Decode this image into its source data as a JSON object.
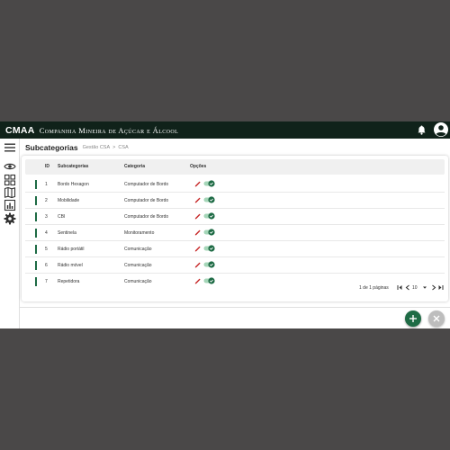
{
  "topbar": {
    "brand": "CMAA",
    "brand_subtitle": "Companhia Mineira de Açúcar e Álcool"
  },
  "header": {
    "title": "Subcategorias",
    "breadcrumb": [
      "Gestão CSA",
      "CSA"
    ],
    "breadcrumb_separator": ">"
  },
  "table": {
    "columns": [
      "ID",
      "Subcategorias",
      "Categoria",
      "Opções"
    ],
    "rows": [
      {
        "id": "1",
        "subcategoria": "Bordo Hexagon",
        "categoria": "Computador de Bordo"
      },
      {
        "id": "2",
        "subcategoria": "Mobilidade",
        "categoria": "Computador de Bordo"
      },
      {
        "id": "3",
        "subcategoria": "CBI",
        "categoria": "Computador de Bordo"
      },
      {
        "id": "4",
        "subcategoria": "Sentinela",
        "categoria": "Monitoramento"
      },
      {
        "id": "5",
        "subcategoria": "Rádio portátil",
        "categoria": "Comunicação"
      },
      {
        "id": "6",
        "subcategoria": "Rádio móvel",
        "categoria": "Comunicação"
      },
      {
        "id": "7",
        "subcategoria": "Repetidora",
        "categoria": "Comunicação"
      }
    ]
  },
  "pagination": {
    "info": "1 de 1 páginas",
    "page_size": "10"
  },
  "colors": {
    "topbar": "#10221a",
    "accent_green": "#1e6b45",
    "edit_red": "#c62828",
    "background": "#4a4848"
  },
  "icons": [
    "menu-icon",
    "eye-icon",
    "dashboard-icon",
    "map-icon",
    "report-icon",
    "gear-icon",
    "bell-icon",
    "account-icon",
    "edit-icon",
    "toggle-on-icon",
    "first-page-icon",
    "prev-page-icon",
    "next-page-icon",
    "last-page-icon",
    "add-icon",
    "close-icon"
  ]
}
